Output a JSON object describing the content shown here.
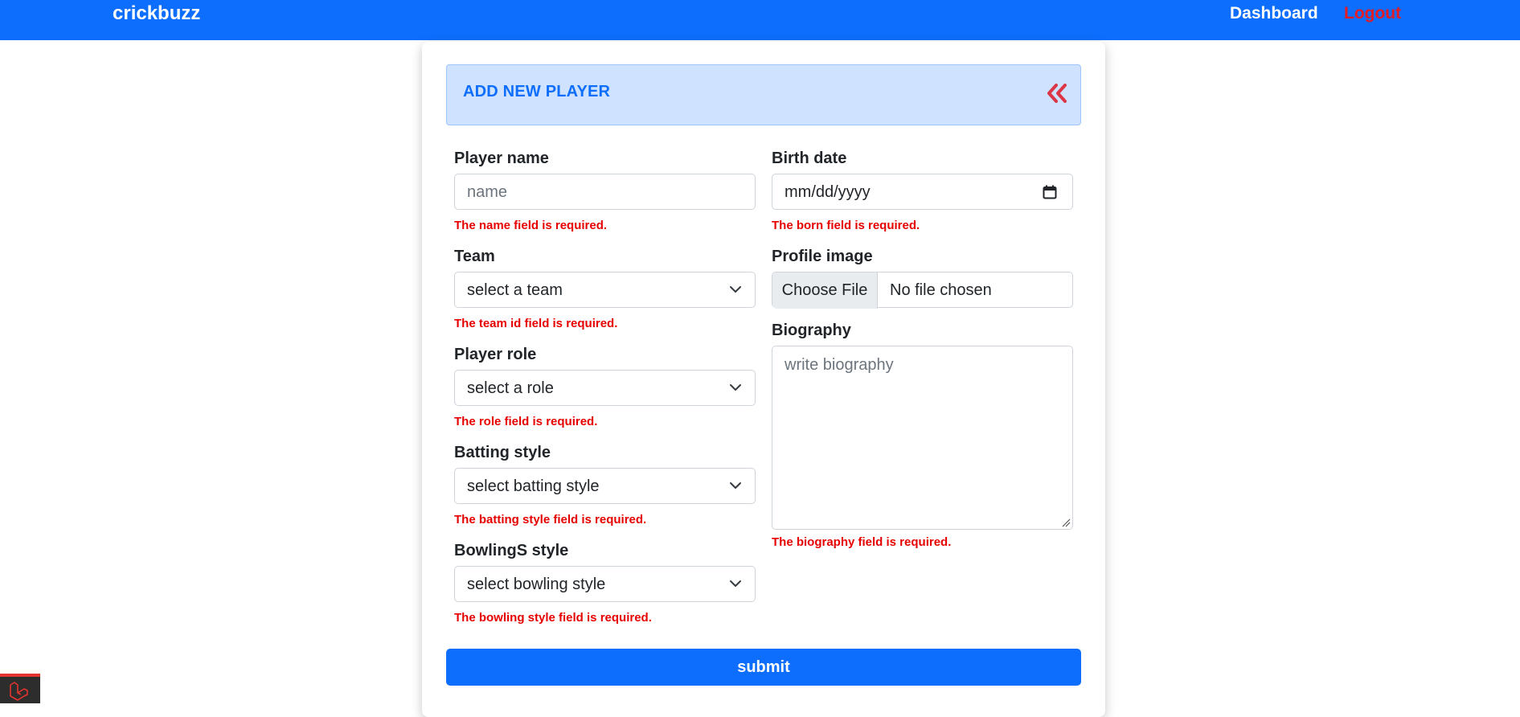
{
  "navbar": {
    "brand": "crickbuzz",
    "dashboard": "Dashboard",
    "logout": "Logout",
    "bg_color": "#0d6efd",
    "logout_color": "#e31b23"
  },
  "card": {
    "title": "ADD NEW PLAYER",
    "back_icon": "double-chevron-left-icon"
  },
  "form": {
    "player_name": {
      "label": "Player name",
      "placeholder": "name",
      "error": "The name field is required."
    },
    "team": {
      "label": "Team",
      "selected": "select a team",
      "error": "The team id field is required."
    },
    "role": {
      "label": "Player role",
      "selected": "select a role",
      "error": "The role field is required."
    },
    "batting": {
      "label": "Batting style",
      "selected": "select batting style",
      "error": "The batting style field is required."
    },
    "bowling": {
      "label": "BowlingS style",
      "selected": "select bowling style",
      "error": "The bowling style field is required."
    },
    "birth_date": {
      "label": "Birth date",
      "value": "mm/dd/yyyy",
      "error": "The born field is required."
    },
    "profile_image": {
      "label": "Profile image",
      "button": "Choose File",
      "status": "No file chosen"
    },
    "biography": {
      "label": "Biography",
      "placeholder": "write biography",
      "error": "The biography field is required."
    },
    "submit": "submit"
  },
  "colors": {
    "error": "#e60000",
    "accent": "#0d6efd",
    "header_bg": "#cfe2ff"
  }
}
